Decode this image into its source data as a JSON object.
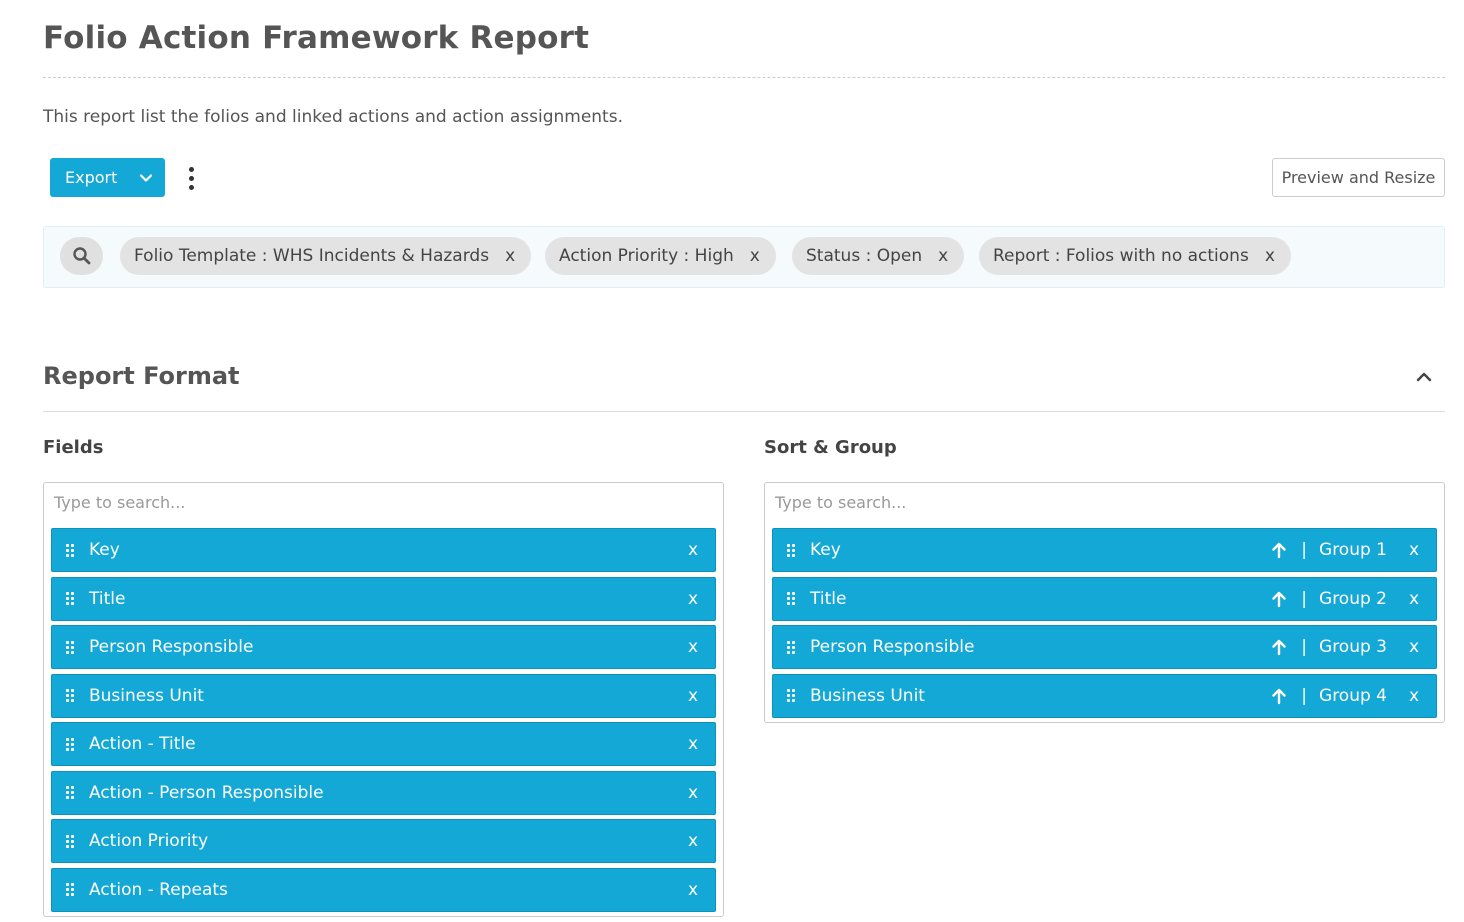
{
  "page": {
    "title": "Folio Action Framework Report",
    "description": "This report list the folios and linked actions and action assignments."
  },
  "toolbar": {
    "export_label": "Export",
    "preview_label": "Preview and Resize"
  },
  "filters": [
    {
      "label": "Folio Template : WHS Incidents & Hazards",
      "remove": "x"
    },
    {
      "label": "Action Priority : High",
      "remove": "x"
    },
    {
      "label": "Status : Open",
      "remove": "x"
    },
    {
      "label": "Report : Folios with no actions",
      "remove": "x"
    }
  ],
  "report_format": {
    "title": "Report Format",
    "fields": {
      "heading": "Fields",
      "search_placeholder": "Type to search...",
      "items": [
        {
          "label": "Key",
          "remove": "x"
        },
        {
          "label": "Title",
          "remove": "x"
        },
        {
          "label": "Person Responsible",
          "remove": "x"
        },
        {
          "label": "Business Unit",
          "remove": "x"
        },
        {
          "label": "Action - Title",
          "remove": "x"
        },
        {
          "label": "Action - Person Responsible",
          "remove": "x"
        },
        {
          "label": "Action Priority",
          "remove": "x"
        },
        {
          "label": "Action - Repeats",
          "remove": "x"
        }
      ]
    },
    "sort_group": {
      "heading": "Sort & Group",
      "search_placeholder": "Type to search...",
      "items": [
        {
          "label": "Key",
          "sort": "ascending",
          "separator": "|",
          "group": "Group 1",
          "remove": "x"
        },
        {
          "label": "Title",
          "sort": "ascending",
          "separator": "|",
          "group": "Group 2",
          "remove": "x"
        },
        {
          "label": "Person Responsible",
          "sort": "ascending",
          "separator": "|",
          "group": "Group 3",
          "remove": "x"
        },
        {
          "label": "Business Unit",
          "sort": "ascending",
          "separator": "|",
          "group": "Group 4",
          "remove": "x"
        }
      ]
    }
  },
  "colors": {
    "accent": "#14a8d6",
    "chip_bg": "#e3e3e3",
    "text": "#555555"
  },
  "icons": [
    "chevron-down-icon",
    "kebab-menu-icon",
    "search-icon",
    "chevron-up-icon",
    "drag-handle-icon",
    "arrow-up-icon"
  ]
}
